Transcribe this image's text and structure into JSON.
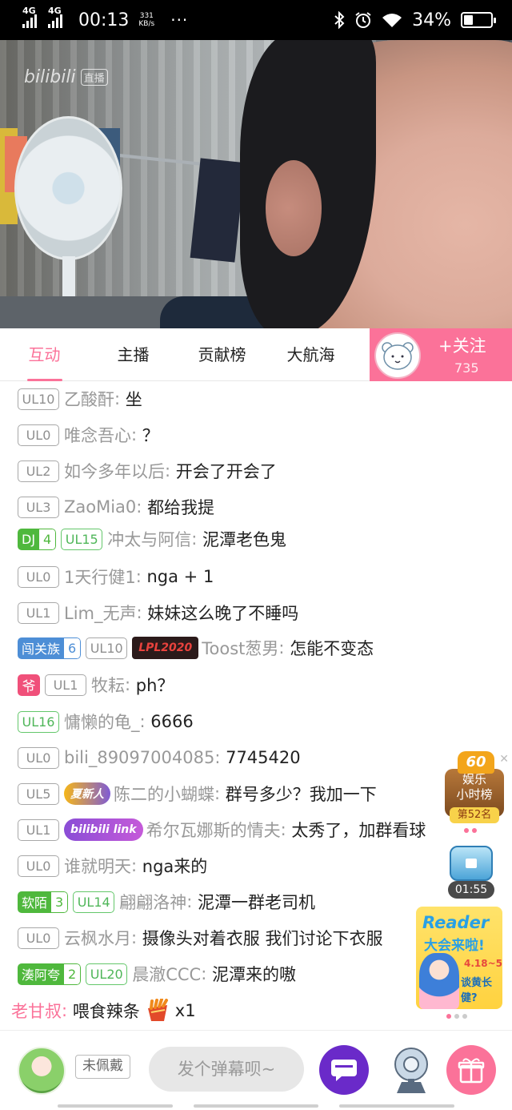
{
  "status_bar": {
    "signal_1": "4G",
    "signal_2": "4G",
    "time": "00:13",
    "speed_value": "331",
    "speed_unit": "KB/s",
    "more": "···",
    "battery": "34%",
    "battery_level": 0.34
  },
  "video": {
    "watermark": "bilibili",
    "watermark_tag": "直播"
  },
  "tabs": [
    {
      "label": "互动",
      "active": true
    },
    {
      "label": "主播",
      "active": false
    },
    {
      "label": "贡献榜",
      "active": false
    },
    {
      "label": "大航海",
      "active": false
    }
  ],
  "follow": {
    "label": "+关注",
    "count": "735"
  },
  "chat": [
    {
      "level": "UL10",
      "user": "乙酸酐",
      "text": "坐"
    },
    {
      "level": "UL0",
      "user": "唯念吾心",
      "text": "？"
    },
    {
      "level": "UL2",
      "user": "如今多年以后",
      "text": "开会了开会了"
    },
    {
      "level": "UL3",
      "user": "ZaoMia0",
      "text": "都给我提"
    },
    {
      "medal_name": "DJ",
      "medal_level": "4",
      "level": "UL15",
      "user": "冲太与阿信",
      "text": "泥潭老色鬼"
    },
    {
      "level": "UL0",
      "user": "1天行健1",
      "text": "nga + 1"
    },
    {
      "level": "UL1",
      "user": "Lim_无声",
      "text": "妹妹这么晚了不睡吗"
    },
    {
      "medal_name": "闯关族",
      "medal_level": "6",
      "level": "UL10",
      "badge": "LPL2020",
      "user": "Toost葱男",
      "text": "怎能不变态"
    },
    {
      "level": "UL1",
      "user": "牧耘",
      "text": "ph？"
    },
    {
      "level": "UL16",
      "user": "慵懒的龟_",
      "text": "6666"
    },
    {
      "level": "UL0",
      "user": "bili_89097004085",
      "text": "7745420"
    },
    {
      "level": "UL5",
      "badge": "夏新人",
      "user": "陈二的小蝴蝶",
      "text": "群号多少？我加一下"
    },
    {
      "level": "UL1",
      "badge": "bilibili link",
      "user": "希尔瓦娜斯的情夫",
      "text": "太秀了，加群看球"
    },
    {
      "level": "UL0",
      "user": "谁就明天",
      "text": "nga来的"
    },
    {
      "medal_name": "软陌",
      "medal_level": "3",
      "level": "UL14",
      "user": "翩翩洛神",
      "text": "泥潭一群老司机"
    },
    {
      "level": "UL0",
      "user": "云枫水月",
      "text": "摄像头对着衣服   我们讨论下衣服"
    },
    {
      "medal_name": "湊阿夸",
      "medal_level": "2",
      "level": "UL20",
      "user": "晨澈CCC",
      "text": "泥潭来的嗷"
    }
  ],
  "gift_message": {
    "user": "老甘叔",
    "action": "喂食辣条",
    "count": "x1"
  },
  "widgets": {
    "rank_crown": "60",
    "rank_title_1": "娱乐",
    "rank_title_2": "小时榜",
    "rank_place": "第52名",
    "box_timer": "01:55",
    "ad_title": "Reader",
    "ad_subtitle": "大会来啦!",
    "ad_dates": "4.18~5.1",
    "ad_tagline": "谈黄长健?"
  },
  "bottom_bar": {
    "no_medal": "未佩戴",
    "danmaku_placeholder": "发个弹幕呗~"
  },
  "colors": {
    "accent": "#fb7299",
    "green": "#4fb83d",
    "blue": "#4d8ed6"
  }
}
